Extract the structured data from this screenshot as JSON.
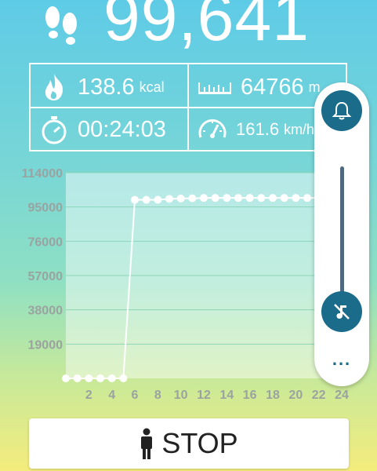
{
  "steps": {
    "count": "99,641"
  },
  "stats": {
    "calories": {
      "value": "138.6",
      "unit": "kcal"
    },
    "distance": {
      "value": "64766",
      "unit": "m"
    },
    "duration": {
      "value": "00:24:03"
    },
    "speed": {
      "value": "161.6",
      "unit": "km/h"
    }
  },
  "chart_data": {
    "type": "line",
    "x": [
      0,
      1,
      2,
      3,
      4,
      5,
      6,
      7,
      8,
      9,
      10,
      11,
      12,
      13,
      14,
      15,
      16,
      17,
      18,
      19,
      20,
      21,
      22
    ],
    "values": [
      0,
      0,
      0,
      0,
      0,
      0,
      99000,
      99000,
      99000,
      99500,
      99700,
      99800,
      100000,
      100000,
      100000,
      100000,
      100000,
      100000,
      100000,
      100000,
      100000,
      100000,
      100000
    ],
    "xlabel": "",
    "ylabel": "",
    "xticks": [
      "2",
      "4",
      "6",
      "8",
      "10",
      "12",
      "14",
      "16",
      "18",
      "20",
      "22",
      "24"
    ],
    "yticks": [
      "19000",
      "38000",
      "57000",
      "76000",
      "95000",
      "114000"
    ],
    "ylim": [
      0,
      114000
    ],
    "xlim": [
      0,
      24
    ],
    "grid": true
  },
  "volume_panel": {
    "more_label": "..."
  },
  "stop_button": {
    "label": "STOP"
  },
  "colors": {
    "accent": "#1a6c8a",
    "line": "#ffffff",
    "grid": "#8ad6b8"
  }
}
